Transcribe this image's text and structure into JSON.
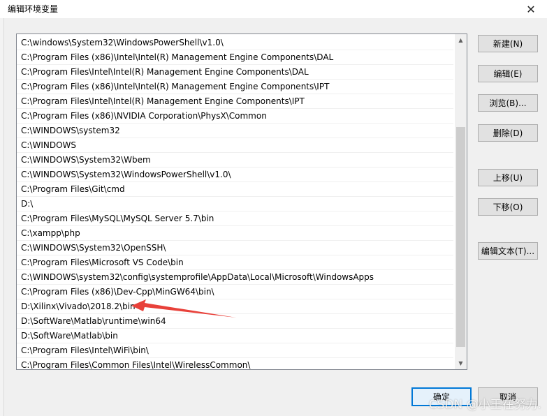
{
  "window": {
    "title": "编辑环境变量",
    "close_glyph": "✕"
  },
  "path_list": {
    "items": [
      "C:\\windows\\System32\\WindowsPowerShell\\v1.0\\",
      "C:\\Program Files (x86)\\Intel\\Intel(R) Management Engine Components\\DAL",
      "C:\\Program Files\\Intel\\Intel(R) Management Engine Components\\DAL",
      "C:\\Program Files (x86)\\Intel\\Intel(R) Management Engine Components\\IPT",
      "C:\\Program Files\\Intel\\Intel(R) Management Engine Components\\IPT",
      "C:\\Program Files (x86)\\NVIDIA Corporation\\PhysX\\Common",
      "C:\\WINDOWS\\system32",
      "C:\\WINDOWS",
      "C:\\WINDOWS\\System32\\Wbem",
      "C:\\WINDOWS\\System32\\WindowsPowerShell\\v1.0\\",
      "C:\\Program Files\\Git\\cmd",
      "D:\\",
      "C:\\Program Files\\MySQL\\MySQL Server 5.7\\bin",
      "C:\\xampp\\php",
      "C:\\WINDOWS\\System32\\OpenSSH\\",
      "C:\\Program Files\\Microsoft VS Code\\bin",
      "C:\\WINDOWS\\system32\\config\\systemprofile\\AppData\\Local\\Microsoft\\WindowsApps",
      "C:\\Program Files (x86)\\Dev-Cpp\\MinGW64\\bin\\",
      "D:\\Xilinx\\Vivado\\2018.2\\bin",
      "D:\\SoftWare\\Matlab\\runtime\\win64",
      "D:\\SoftWare\\Matlab\\bin",
      "C:\\Program Files\\Intel\\WiFi\\bin\\",
      "C:\\Program Files\\Common Files\\Intel\\WirelessCommon\\"
    ]
  },
  "buttons": {
    "new": "新建(N)",
    "edit": "编辑(E)",
    "browse": "浏览(B)...",
    "delete": "删除(D)",
    "move_up": "上移(U)",
    "move_down": "下移(O)",
    "edit_text": "编辑文本(T)...",
    "ok": "确定",
    "cancel": "取消"
  },
  "annotation": {
    "target_item": "D:\\Xilinx\\Vivado\\2018.2\\bin",
    "arrow_color": "#e8413a"
  },
  "watermark": "CSDN @小王在努力.",
  "colors": {
    "dialog_bg": "#f0f0f0",
    "button_bg": "#e1e1e1",
    "focus_border": "#0078d7"
  }
}
